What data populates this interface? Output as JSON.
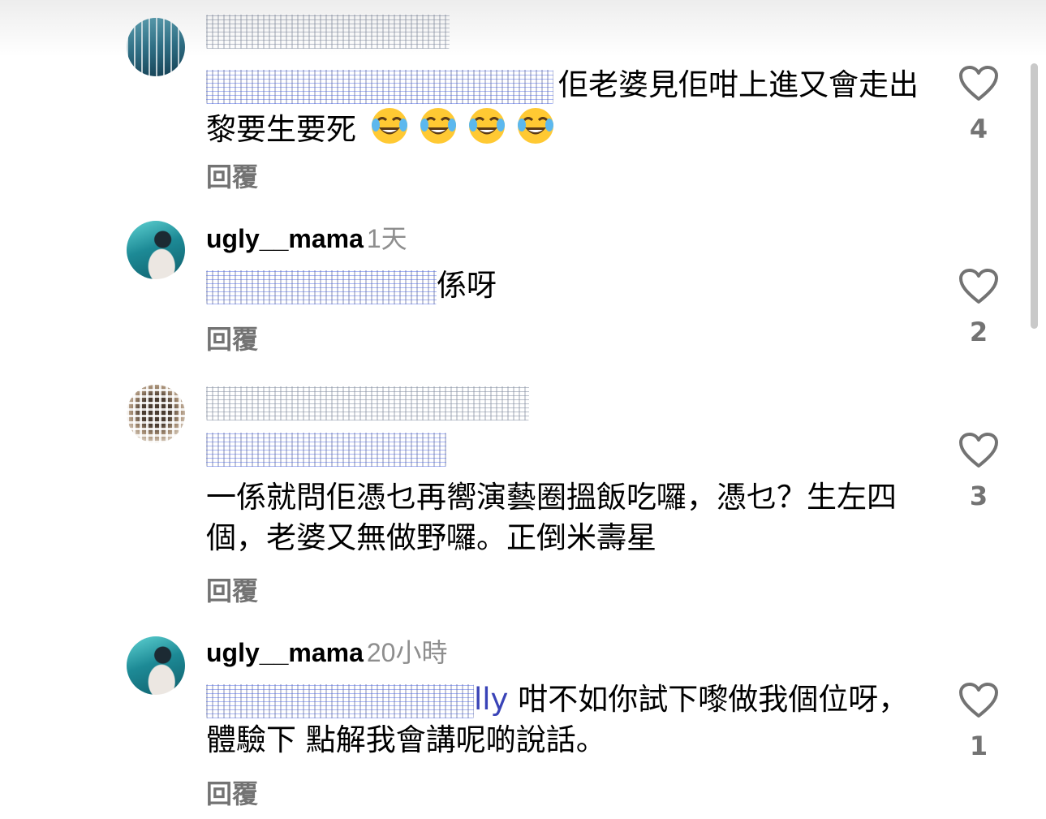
{
  "comments": [
    {
      "username": "",
      "time": "",
      "mention": "",
      "text": "佢老婆見佢咁上進又會走出黎要生要死",
      "emojis": [
        "😂",
        "😂",
        "😂",
        "😂"
      ],
      "reply_label": "回覆",
      "likes": "4"
    },
    {
      "username": "ugly__mama",
      "time": "1天",
      "mention": "",
      "text": "係呀",
      "reply_label": "回覆",
      "likes": "2"
    },
    {
      "username": "",
      "time": "",
      "mention": "",
      "text": "一係就問佢憑乜再嚮演藝圈搵飯吃囉，憑乜？生左四個，老婆又無做野囉。正倒米壽星",
      "reply_label": "回覆",
      "likes": "3"
    },
    {
      "username": "ugly__mama",
      "time": "20小時",
      "mention": "lly",
      "text": " 咁不如你試下嚟做我個位呀， 體驗下 點解我會講呢啲說話。",
      "reply_label": "回覆",
      "likes": "1"
    }
  ],
  "icons": {
    "like": "heart-outline-icon",
    "emoji": "face-with-tears-of-joy"
  },
  "colors": {
    "mention": "#3943b7",
    "secondary_text": "#737373",
    "timestamp": "#8e8e8e"
  }
}
